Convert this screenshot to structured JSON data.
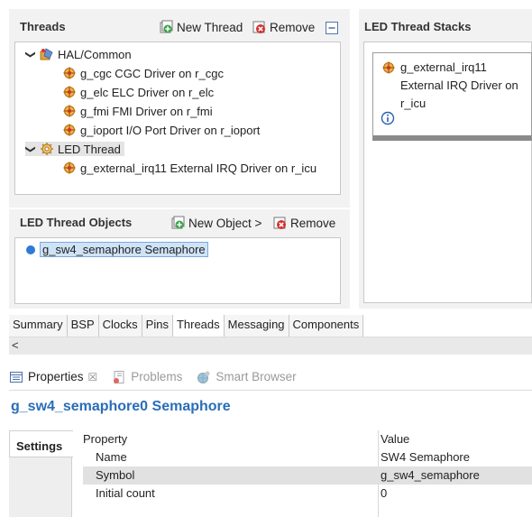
{
  "threads_panel": {
    "title": "Threads",
    "new_thread_label": "New Thread",
    "remove_label": "Remove",
    "tree": [
      {
        "label": "HAL/Common",
        "level": 0,
        "expanded": true,
        "icon": "hal-folder-icon"
      },
      {
        "label": "g_cgc CGC Driver on r_cgc",
        "level": 1,
        "icon": "driver-module-icon"
      },
      {
        "label": "g_elc ELC Driver on r_elc",
        "level": 1,
        "icon": "driver-module-icon"
      },
      {
        "label": "g_fmi FMI Driver on r_fmi",
        "level": 1,
        "icon": "driver-module-icon"
      },
      {
        "label": "g_ioport I/O Port Driver on r_ioport",
        "level": 1,
        "icon": "driver-module-icon"
      },
      {
        "label": "LED Thread",
        "level": 0,
        "expanded": true,
        "selected": true,
        "icon": "thread-gear-icon"
      },
      {
        "label": "g_external_irq11 External IRQ Driver on r_icu",
        "level": 1,
        "icon": "driver-module-icon"
      }
    ]
  },
  "objects_panel": {
    "title": "LED Thread Objects",
    "new_object_label": "New Object >",
    "remove_label": "Remove",
    "items": [
      {
        "label": "g_sw4_semaphore Semaphore",
        "icon": "semaphore-icon"
      }
    ]
  },
  "stacks_panel": {
    "title": "LED Thread Stacks",
    "card": {
      "line1": "g_external_irq11",
      "line2": "External IRQ Driver on",
      "line3": "r_icu",
      "info_icon": "info-icon"
    }
  },
  "config_tabs": [
    {
      "label": "Summary"
    },
    {
      "label": "BSP"
    },
    {
      "label": "Clocks"
    },
    {
      "label": "Pins"
    },
    {
      "label": "Threads",
      "active": true
    },
    {
      "label": "Messaging"
    },
    {
      "label": "Components"
    }
  ],
  "scroll_arrow": "<",
  "views": {
    "properties_label": "Properties",
    "properties_close": "☒",
    "problems_label": "Problems",
    "smart_browser_label": "Smart Browser"
  },
  "properties": {
    "object_title": "g_sw4_semaphore0 Semaphore",
    "settings_tab": "Settings",
    "header_property": "Property",
    "header_value": "Value",
    "rows": [
      {
        "key": "Name",
        "value": "SW4 Semaphore"
      },
      {
        "key": "Symbol",
        "value": "g_sw4_semaphore",
        "selected": true
      },
      {
        "key": "Initial count",
        "value": "0"
      }
    ]
  },
  "colors": {
    "accent_blue": "#2a6db8",
    "selection_blue": "#cfe3f7",
    "panel_bg": "#f2f2f2",
    "remove_red": "#d22f2f",
    "add_green": "#3aa34a"
  }
}
